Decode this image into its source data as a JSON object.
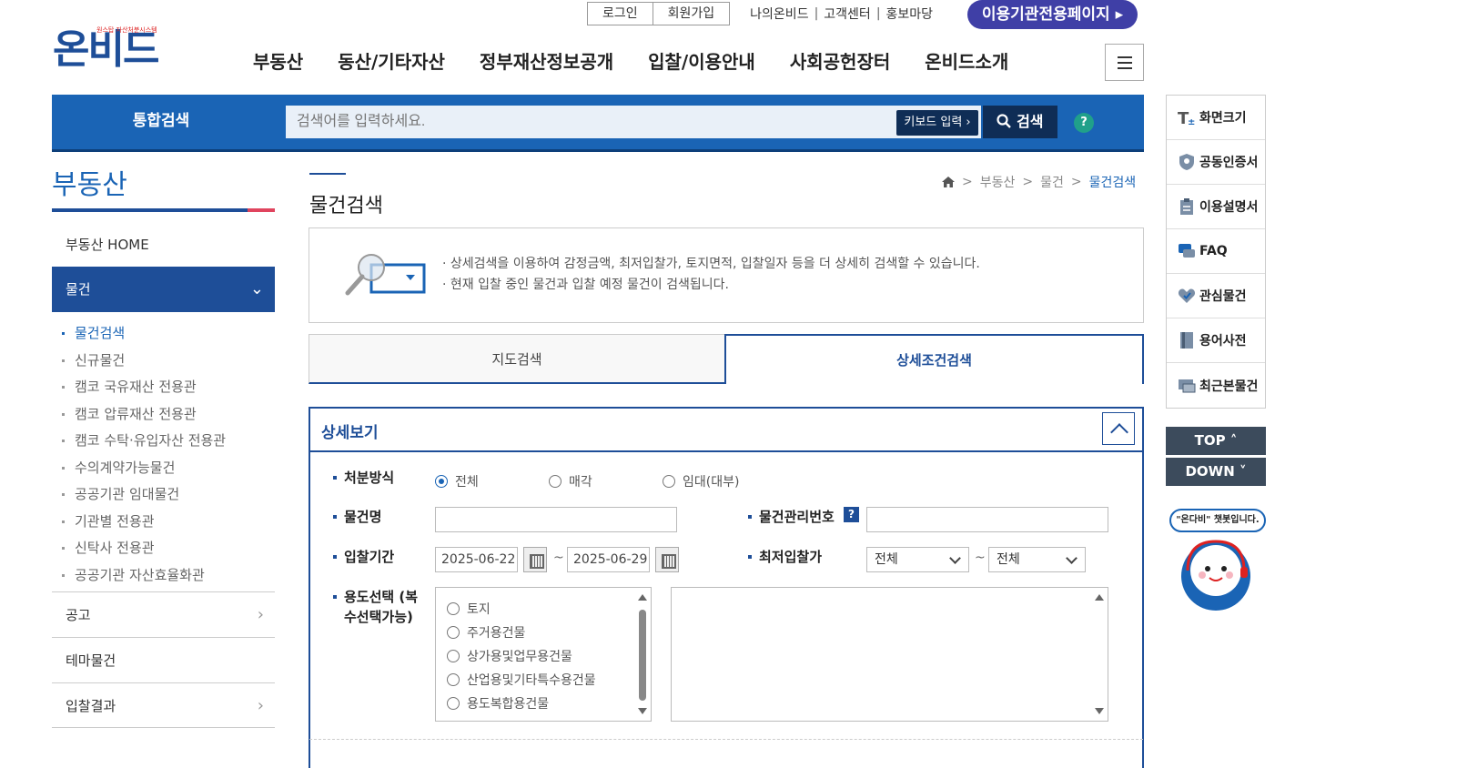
{
  "util": {
    "login": "로그인",
    "join": "회원가입",
    "links": [
      "나의온비드",
      "고객센터",
      "홍보마당"
    ],
    "org_page": "이용기관전용페이지"
  },
  "logo": {
    "main": "온비드",
    "sub": "원스탑 자산처분시스템"
  },
  "gnb": [
    "부동산",
    "동산/기타자산",
    "정부재산정보공개",
    "입찰/이용안내",
    "사회공헌장터",
    "온비드소개"
  ],
  "search": {
    "label": "통합검색",
    "placeholder": "검색어를 입력하세요.",
    "keyboard": "키보드 입력",
    "button": "검색",
    "help": "?"
  },
  "sidebar": {
    "title": "부동산",
    "home": "부동산 HOME",
    "active": "물건",
    "sub": [
      "물건검색",
      "신규물건",
      "캠코 국유재산 전용관",
      "캠코 압류재산 전용관",
      "캠코 수탁·유입자산 전용관",
      "수의계약가능물건",
      "공공기관 임대물건",
      "기관별 전용관",
      "신탁사 전용관",
      "공공기관 자산효율화관"
    ],
    "groups": [
      "공고",
      "테마물건",
      "입찰결과"
    ]
  },
  "content": {
    "title": "물건검색",
    "breadcrumb": [
      "부동산",
      "물건",
      "물건검색"
    ],
    "info": [
      "상세검색을 이용하여 감정금액, 최저입찰가, 토지면적, 입찰일자 등을 더 상세히 검색할 수 있습니다.",
      "현재 입찰 중인 물건과 입찰 예정 물건이 검색됩니다."
    ],
    "tabs": [
      "지도검색",
      "상세조건검색"
    ],
    "detail_title": "상세보기",
    "form": {
      "disposal_label": "처분방식",
      "disposal_options": [
        "전체",
        "매각",
        "임대(대부)"
      ],
      "name_label": "물건명",
      "mgmt_label": "물건관리번호",
      "period_label": "입찰기간",
      "date_from": "2025-06-22",
      "date_to": "2025-06-29",
      "min_bid_label": "최저입찰가",
      "min_bid_from": "전체",
      "min_bid_to": "전체",
      "usage_label": "용도선택 (복수선택가능)",
      "usage_options": [
        "토지",
        "주거용건물",
        "상가용및업무용건물",
        "산업용및기타특수용건물",
        "용도복합용건물"
      ],
      "tilde": "~"
    }
  },
  "quick": {
    "items": [
      "화면크기",
      "공동인증서",
      "이용설명서",
      "FAQ",
      "관심물건",
      "용어사전",
      "최근본물건"
    ],
    "top": "TOP",
    "down": "DOWN",
    "chatbot": "\"온다비\" 챗봇입니다."
  }
}
